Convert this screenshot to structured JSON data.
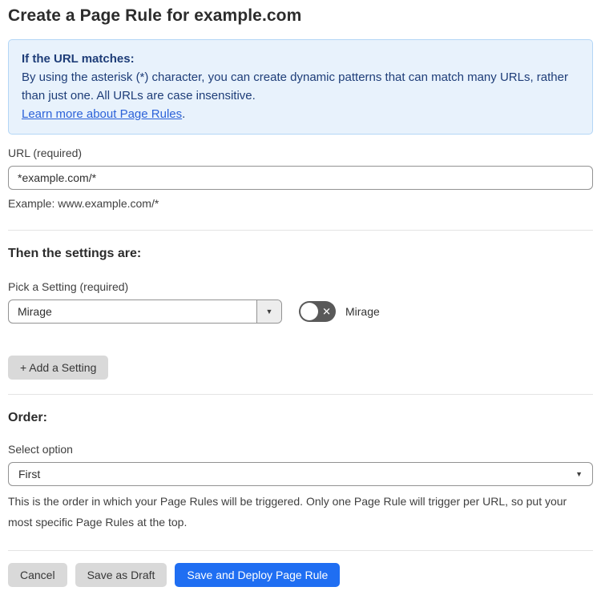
{
  "page": {
    "title": "Create a Page Rule for example.com"
  },
  "info_box": {
    "heading": "If the URL matches:",
    "body": "By using the asterisk (*) character, you can create dynamic patterns that can match many URLs, rather than just one. All URLs are case insensitive.",
    "link_label": "Learn more about Page Rules",
    "link_suffix": "."
  },
  "url_field": {
    "label": "URL (required)",
    "value": "*example.com/*",
    "helper": "Example: www.example.com/*"
  },
  "settings_section": {
    "heading": "Then the settings are:",
    "setting_label": "Pick a Setting (required)",
    "setting_value": "Mirage",
    "toggle_label": "Mirage",
    "toggle_state": "off",
    "add_setting_label": "+ Add a Setting"
  },
  "order_section": {
    "heading": "Order:",
    "select_label": "Select option",
    "select_value": "First",
    "helper": "This is the order in which your Page Rules will be triggered. Only one Page Rule will trigger per URL, so put your most specific Page Rules at the top."
  },
  "actions": {
    "cancel_label": "Cancel",
    "save_draft_label": "Save as Draft",
    "save_deploy_label": "Save and Deploy Page Rule"
  },
  "icons": {
    "dropdown_caret": "▼",
    "toggle_off_glyph": "✕"
  },
  "colors": {
    "info_bg": "#e8f2fc",
    "info_border": "#b3d6f6",
    "info_text": "#1e3d78",
    "link_blue": "#2c62d9",
    "primary_blue": "#1f6ef2",
    "button_gray": "#d9d9d9",
    "toggle_gray": "#595959",
    "input_border": "#929292",
    "divider_gray": "#e4e4e4"
  }
}
